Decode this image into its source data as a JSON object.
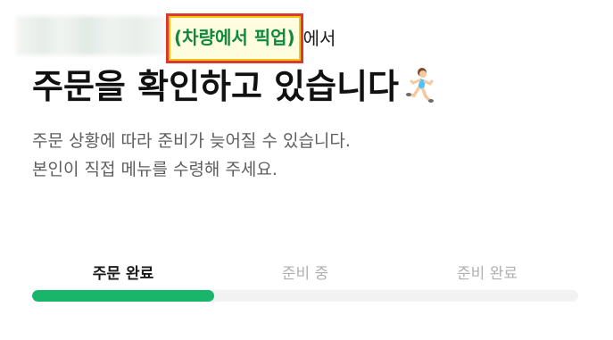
{
  "header": {
    "pickup_method": "(차량에서 픽업)",
    "suffix": "에서"
  },
  "title": "주문을 확인하고 있습니다",
  "title_icon": "running-person-icon",
  "notice": {
    "line1": "주문 상황에 따라 준비가 늦어질 수 있습니다.",
    "line2": "본인이 직접 메뉴를 수령해 주세요."
  },
  "progress": {
    "steps": [
      {
        "label": "주문 완료",
        "active": true
      },
      {
        "label": "준비 중",
        "active": false
      },
      {
        "label": "준비 완료",
        "active": false
      }
    ],
    "completed_fraction": 0.333,
    "fill_color": "#19b56a",
    "track_color": "#f2f2f2"
  },
  "colors": {
    "pickup_text": "#0f8a3c",
    "highlight_border": "#d93a2b",
    "title": "#111111",
    "notice": "#5e5e5e",
    "inactive_step": "#b0b0b0"
  }
}
